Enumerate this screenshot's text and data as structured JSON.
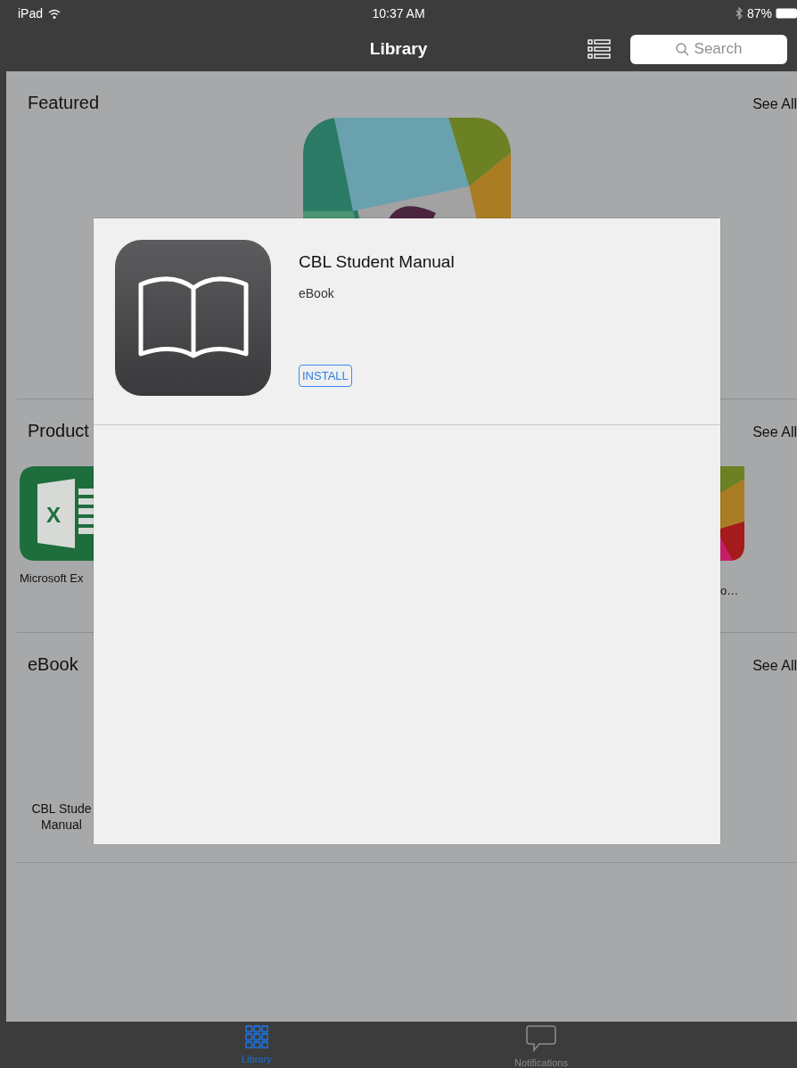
{
  "status_bar": {
    "device": "iPad",
    "time": "10:37 AM",
    "battery": "87%"
  },
  "nav_bar": {
    "title": "Library",
    "search": {
      "placeholder": "Search"
    }
  },
  "sections": [
    {
      "kind": "featured",
      "title": "Featured",
      "see_all": "See All",
      "apps": [
        {
          "kind": "tiles"
        }
      ]
    },
    {
      "kind": "apps",
      "title": "Product",
      "see_all": "See All",
      "apps": [
        {
          "kind": "spreadsheet",
          "glyph": "X",
          "lines": [
            "Microsoft Ex"
          ]
        },
        {
          "kind": "tiles-edge",
          "lines": [
            "o…"
          ]
        }
      ]
    },
    {
      "kind": "books",
      "title": "eBook",
      "see_all": "See All",
      "apps": [
        {
          "lines": [
            "CBL Stude",
            "Manual"
          ]
        }
      ]
    }
  ],
  "modal": {
    "title": "CBL Student Manual",
    "type": "eBook",
    "button": "INSTALL"
  },
  "tabs": [
    {
      "label": "Library",
      "kind": "grid",
      "selected": true
    },
    {
      "label": "Notifications",
      "kind": "bubble",
      "selected": false
    }
  ]
}
